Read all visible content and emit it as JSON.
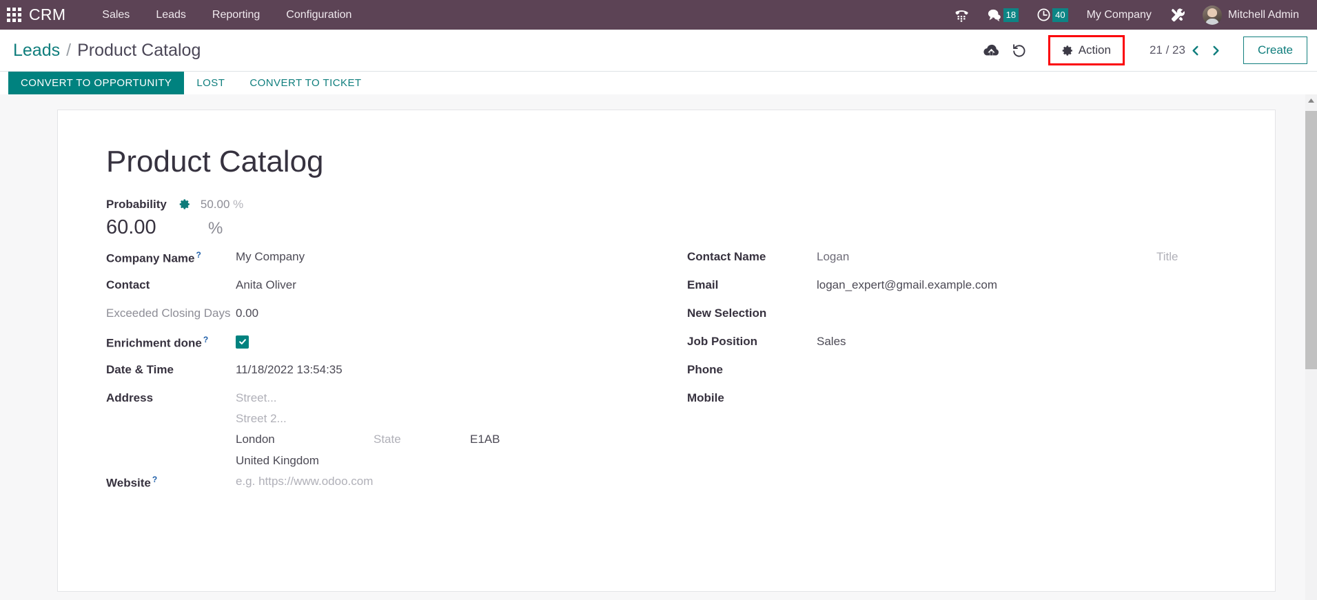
{
  "navbar": {
    "apps_icon": "apps-grid-icon",
    "brand": "CRM",
    "menu": [
      {
        "label": "Sales"
      },
      {
        "label": "Leads"
      },
      {
        "label": "Reporting"
      },
      {
        "label": "Configuration"
      }
    ],
    "systray": [
      {
        "name": "voip-phone-icon",
        "badge": null
      },
      {
        "name": "messaging-chat-icon",
        "badge": "18"
      },
      {
        "name": "activities-clock-icon",
        "badge": "40"
      }
    ],
    "company": "My Company",
    "debug_icon": "tools-wrench-icon",
    "user": "Mitchell Admin"
  },
  "control_panel": {
    "breadcrumb": {
      "parent": "Leads",
      "separator": "/",
      "current": "Product Catalog"
    },
    "upload_icon": "cloud-upload-icon",
    "discard_icon": "undo-discard-icon",
    "action_label": "Action",
    "action_icon": "gear-icon",
    "action_highlight_color": "#fb0007",
    "pager": {
      "count": "21 / 23",
      "previous_icon": "chevron-left-icon",
      "next_icon": "chevron-right-icon"
    },
    "create_label": "Create"
  },
  "statusbar": {
    "buttons": [
      {
        "label": "Convert to Opportunity",
        "primary": true
      },
      {
        "label": "Lost",
        "primary": false
      },
      {
        "label": "Convert to Ticket",
        "primary": false
      }
    ]
  },
  "form": {
    "title": "Product Catalog",
    "probability": {
      "label": "Probability",
      "gear_icon": "gear-icon",
      "automated_value": "50.00",
      "automated_unit": "%",
      "value": "60.00",
      "unit": "%"
    },
    "left_fields": [
      {
        "label": "Company Name",
        "help": "?",
        "value": "My Company",
        "type": "text",
        "muted_label": false
      },
      {
        "label": "Contact",
        "help": "",
        "value": "Anita Oliver",
        "type": "text",
        "muted_label": false
      },
      {
        "label": "Exceeded Closing Days",
        "help": "",
        "value": "0.00",
        "type": "text",
        "muted_label": true
      },
      {
        "label": "Enrichment done",
        "help": "?",
        "value": "",
        "type": "checkbox",
        "checked": true,
        "muted_label": false
      },
      {
        "label": "Date & Time",
        "help": "",
        "value": "11/18/2022 13:54:35",
        "type": "text",
        "muted_label": false
      }
    ],
    "address": {
      "label": "Address",
      "street_placeholder": "Street...",
      "street2_placeholder": "Street 2...",
      "city": "London",
      "state_placeholder": "State",
      "zip": "E1AB",
      "country": "United Kingdom"
    },
    "website": {
      "label": "Website",
      "help": "?",
      "placeholder": "e.g. https://www.odoo.com"
    },
    "right_fields": [
      {
        "label": "Contact Name",
        "help": "",
        "value": "Logan",
        "extra_placeholder": "Title",
        "type": "contact-name",
        "muted_label": false
      },
      {
        "label": "Email",
        "help": "",
        "value": "logan_expert@gmail.example.com",
        "type": "text",
        "muted_label": false
      },
      {
        "label": "New Selection",
        "help": "",
        "value": "",
        "type": "text",
        "muted_label": false
      },
      {
        "label": "Job Position",
        "help": "",
        "value": "Sales",
        "type": "text",
        "muted_label": false
      },
      {
        "label": "Phone",
        "help": "",
        "value": "",
        "type": "text",
        "muted_label": false
      },
      {
        "label": "Mobile",
        "help": "",
        "value": "",
        "type": "text",
        "muted_label": false
      }
    ]
  },
  "colors": {
    "navbar_bg": "#5c4355",
    "accent_teal": "#00827f",
    "link_teal": "#107e7d",
    "highlight_red": "#fb0007",
    "badge_teal": "#0d8585"
  }
}
